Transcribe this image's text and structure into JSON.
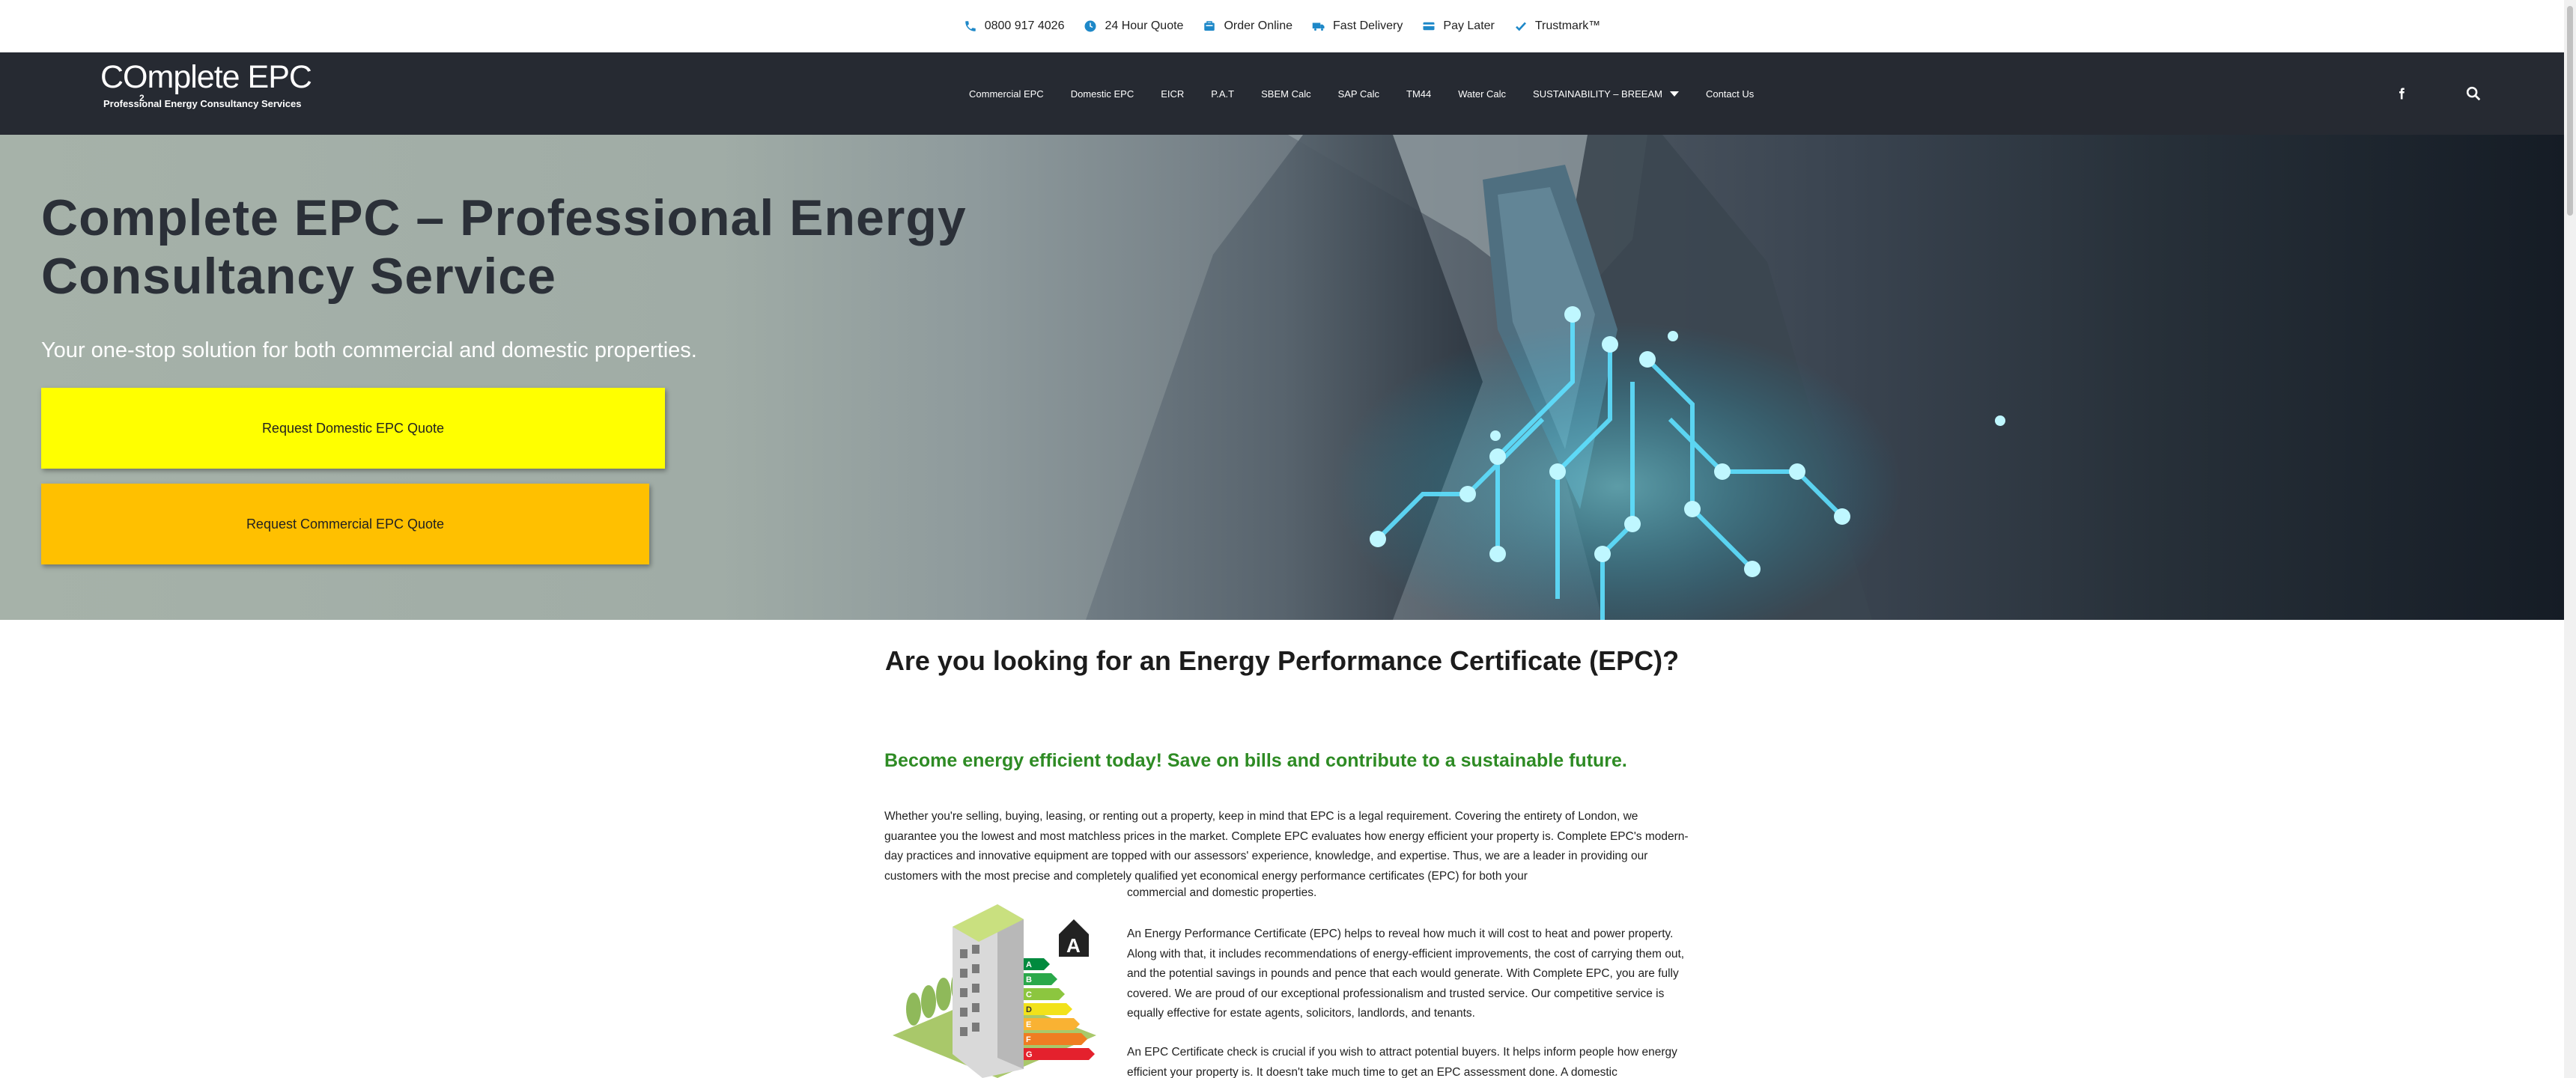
{
  "topbar": {
    "items": [
      {
        "label": "0800 917 4026",
        "icon": "phone-icon"
      },
      {
        "label": "24 Hour Quote",
        "icon": "clock-icon"
      },
      {
        "label": "Order Online",
        "icon": "cart-icon"
      },
      {
        "label": "Fast Delivery",
        "icon": "truck-icon"
      },
      {
        "label": "Pay Later",
        "icon": "credit-card-icon"
      },
      {
        "label": "Trustmark™",
        "icon": "check-badge-icon"
      }
    ],
    "icon_color": "#1e88c8"
  },
  "header": {
    "logo_text": "COmplete EPC",
    "logo_sub": "2",
    "logo_tagline": "Professional Energy Consultancy Services",
    "nav": [
      "Commercial EPC",
      "Domestic EPC",
      "EICR",
      "P.A.T",
      "SBEM Calc",
      "SAP Calc",
      "TM44",
      "Water Calc",
      "SUSTAINABILITY – BREEAM",
      "Contact Us"
    ],
    "background": "#262a32"
  },
  "hero": {
    "title": "Complete EPC – Professional Energy Consultancy Service",
    "subtitle": "Your one-stop solution for both commercial and domestic properties.",
    "btn_domestic": "Request Domestic EPC Quote",
    "btn_commercial": "Request Commercial EPC Quote",
    "btn_domestic_color": "#ffff00",
    "btn_commercial_color": "#ffc000"
  },
  "content": {
    "heading": "Are you looking for an Energy Performance Certificate (EPC)?",
    "green_heading": "Become energy efficient today! Save on bills and contribute to a sustainable future.",
    "green_color": "#2e8b24",
    "para1": "Whether you're selling, buying, leasing, or renting out a property, keep in mind that EPC is a legal requirement. Covering the entirety of  London, we guarantee you the lowest and most matchless prices in the market. Complete EPC evaluates how energy efficient your property is. Complete EPC's modern-day practices and innovative equipment are topped with our assessors' experience, knowledge, and expertise. Thus, we are a leader in providing our customers with the most precise and completely qualified yet economical energy performance certificates (EPC) for both your",
    "para1_tail": "commercial and domestic properties.",
    "para2": "An Energy Performance Certificate (EPC) helps to reveal how much it will cost to heat and power property. Along with that, it includes recommendations of energy-efficient improvements, the cost of carrying them out, and the potential savings in pounds and pence that each would generate. With Complete EPC, you are fully covered. We are proud of our exceptional professionalism and trusted service. Our competitive service is equally effective for estate agents, solicitors, landlords, and tenants.",
    "para3": "An EPC Certificate check  is crucial if you wish to attract potential buyers. It helps inform people how energy efficient your property is. It doesn't take much time to get an EPC assessment done. A domestic",
    "rating_letters": [
      "A",
      "B",
      "C",
      "D",
      "E",
      "F",
      "G"
    ],
    "rating_badge": "A"
  }
}
